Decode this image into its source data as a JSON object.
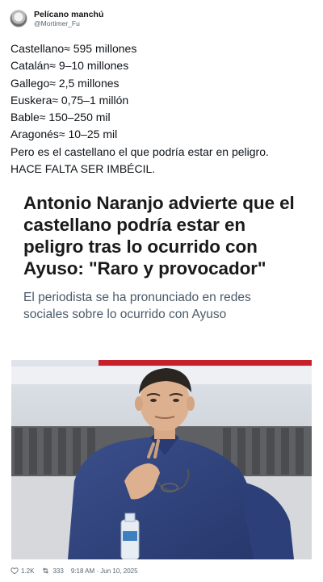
{
  "author": {
    "display_name": "Pelícano manchú",
    "handle": "@Mortimer_Fu"
  },
  "tweet": {
    "lines": [
      "Castellano≈ 595 millones",
      "Catalán≈ 9–10 millones",
      "Gallego≈ 2,5 millones",
      "Euskera≈ 0,75–1 millón",
      "Bable≈ 150–250 mil",
      "Aragonés≈ 10–25 mil",
      "Pero es el castellano el que podría estar en peligro.",
      "HACE FALTA SER IMBÉCIL."
    ]
  },
  "article": {
    "headline": "Antonio Naranjo advierte que el castellano podría estar en peligro tras lo ocurrido con Ayuso: \"Raro y provocador\"",
    "subheadline": "El periodista se ha pronunciado en redes sociales sobre lo ocurrido con Ayuso"
  },
  "footer": {
    "likes": "1.2K",
    "retweets": "333",
    "timestamp": "9:18 AM · Jun 10, 2025"
  },
  "icons": {
    "likes": "heart-icon",
    "retweets": "retweet-icon"
  },
  "colors": {
    "text": "#0f1419",
    "muted": "#536471",
    "subheadline": "#4a5a6a",
    "studio_red_band": "#c8202a"
  }
}
